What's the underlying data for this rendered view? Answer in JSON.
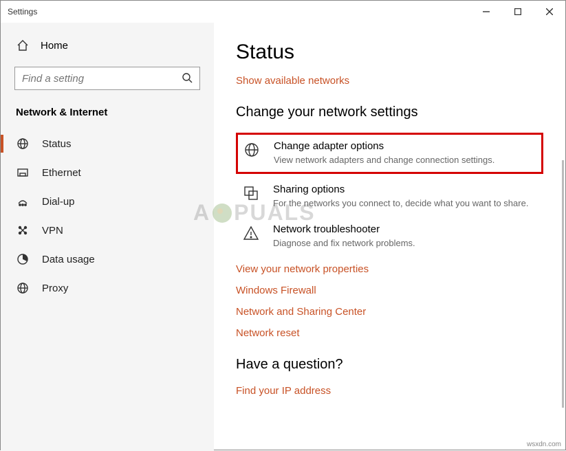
{
  "window": {
    "title": "Settings"
  },
  "sidebar": {
    "home": "Home",
    "search_placeholder": "Find a setting",
    "category": "Network & Internet",
    "items": [
      {
        "label": "Status"
      },
      {
        "label": "Ethernet"
      },
      {
        "label": "Dial-up"
      },
      {
        "label": "VPN"
      },
      {
        "label": "Data usage"
      },
      {
        "label": "Proxy"
      }
    ]
  },
  "content": {
    "heading": "Status",
    "show_networks": "Show available networks",
    "section_change": "Change your network settings",
    "options": [
      {
        "title": "Change adapter options",
        "desc": "View network adapters and change connection settings."
      },
      {
        "title": "Sharing options",
        "desc": "For the networks you connect to, decide what you want to share."
      },
      {
        "title": "Network troubleshooter",
        "desc": "Diagnose and fix network problems."
      }
    ],
    "links": [
      "View your network properties",
      "Windows Firewall",
      "Network and Sharing Center",
      "Network reset"
    ],
    "question_heading": "Have a question?",
    "question_link": "Find your IP address"
  },
  "watermark": "A  PUALS",
  "footer": "wsxdn.com"
}
